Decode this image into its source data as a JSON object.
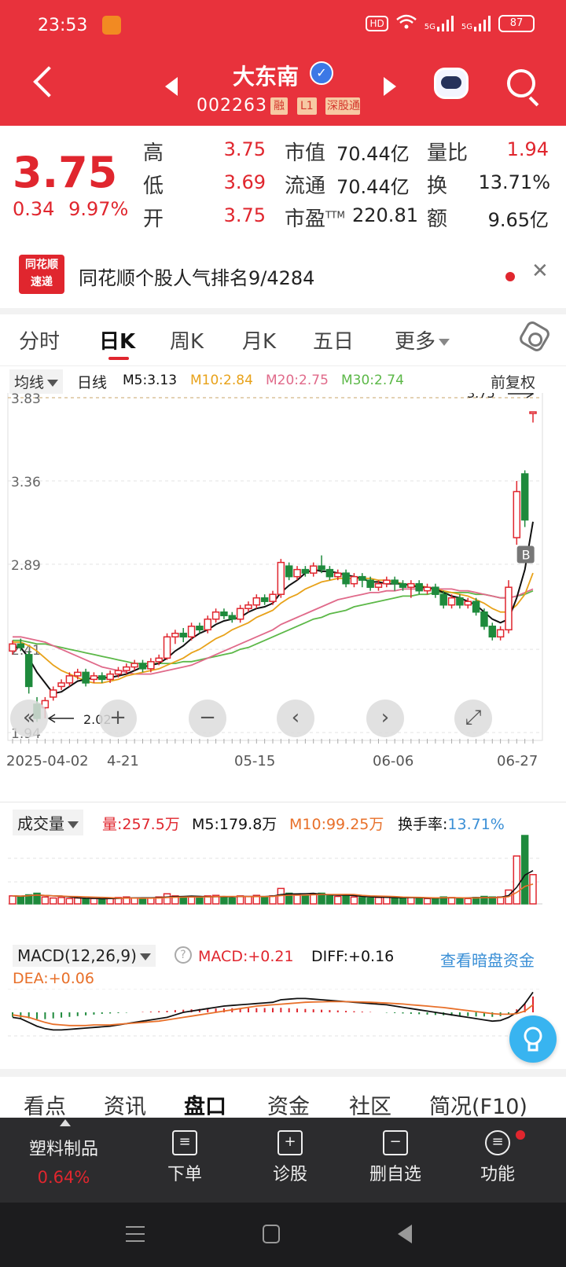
{
  "status_bar": {
    "time": "23:53",
    "network": "HD",
    "sim1": "5G",
    "sim2": "5G",
    "battery": "87"
  },
  "header": {
    "stock_name": "大东南",
    "stock_code": "002263",
    "tags": [
      "融",
      "L1",
      "深股通"
    ]
  },
  "quote": {
    "price": "3.75",
    "change": "0.34",
    "change_pct": "9.97%",
    "labels": {
      "high": "高",
      "low": "低",
      "open": "开",
      "mktcap": "市值",
      "float": "流通",
      "pe": "市盈",
      "pe_sup": "TTM",
      "vol_ratio": "量比",
      "turnover": "换",
      "amount": "额"
    },
    "high": "3.75",
    "low": "3.69",
    "open": "3.75",
    "mktcap": "70.44亿",
    "float": "70.44亿",
    "pe": "220.81",
    "vol_ratio": "1.94",
    "turnover": "13.71%",
    "amount": "9.65亿"
  },
  "ths_banner": {
    "logo_line1": "同花顺",
    "logo_line2": "速递",
    "text": "同花顺个股人气排名9/4284"
  },
  "tabs": [
    "分时",
    "日K",
    "周K",
    "月K",
    "五日",
    "更多"
  ],
  "active_tab": "日K",
  "ma_bar": {
    "button": "均线",
    "period": "日线",
    "m5": "M5:3.13",
    "m10": "M10:2.84",
    "m20": "M20:2.75",
    "m30": "M30:2.74",
    "adjust": "前复权"
  },
  "colors": {
    "up": "#e0262e",
    "down": "#1e8a3c",
    "m5": "#111111",
    "m10": "#e8a21a",
    "m20": "#e06a8a",
    "m30": "#5cb848",
    "accent": "#e8323c"
  },
  "chart_data": {
    "type": "candlestick",
    "y_ticks": [
      "3.83",
      "3.36",
      "2.89",
      "2.41",
      "1.94"
    ],
    "x_ticks": [
      "2025-04-02",
      "4-21",
      "05-15",
      "06-06",
      "06-27"
    ],
    "max_label": "3.75",
    "min_label": "2.02",
    "marker": "B",
    "candles": [
      [
        2.4,
        2.44,
        2.38,
        2.46
      ],
      [
        2.44,
        2.42,
        2.4,
        2.47
      ],
      [
        2.38,
        2.2,
        2.16,
        2.4
      ],
      [
        2.1,
        2.02,
        2.0,
        2.14
      ],
      [
        2.08,
        2.12,
        2.02,
        2.14
      ],
      [
        2.14,
        2.18,
        2.12,
        2.2
      ],
      [
        2.2,
        2.22,
        2.18,
        2.24
      ],
      [
        2.22,
        2.26,
        2.2,
        2.28
      ],
      [
        2.26,
        2.28,
        2.24,
        2.3
      ],
      [
        2.28,
        2.22,
        2.2,
        2.3
      ],
      [
        2.24,
        2.26,
        2.22,
        2.28
      ],
      [
        2.26,
        2.24,
        2.22,
        2.28
      ],
      [
        2.24,
        2.27,
        2.22,
        2.29
      ],
      [
        2.27,
        2.29,
        2.25,
        2.31
      ],
      [
        2.29,
        2.31,
        2.27,
        2.33
      ],
      [
        2.31,
        2.33,
        2.29,
        2.35
      ],
      [
        2.33,
        2.3,
        2.28,
        2.35
      ],
      [
        2.3,
        2.34,
        2.28,
        2.36
      ],
      [
        2.34,
        2.36,
        2.32,
        2.38
      ],
      [
        2.36,
        2.48,
        2.35,
        2.5
      ],
      [
        2.48,
        2.5,
        2.44,
        2.52
      ],
      [
        2.5,
        2.48,
        2.45,
        2.53
      ],
      [
        2.48,
        2.54,
        2.46,
        2.56
      ],
      [
        2.54,
        2.52,
        2.5,
        2.56
      ],
      [
        2.52,
        2.58,
        2.5,
        2.6
      ],
      [
        2.58,
        2.62,
        2.56,
        2.64
      ],
      [
        2.62,
        2.6,
        2.58,
        2.64
      ],
      [
        2.6,
        2.58,
        2.56,
        2.62
      ],
      [
        2.58,
        2.64,
        2.56,
        2.66
      ],
      [
        2.64,
        2.66,
        2.62,
        2.68
      ],
      [
        2.66,
        2.7,
        2.64,
        2.72
      ],
      [
        2.7,
        2.68,
        2.66,
        2.72
      ],
      [
        2.68,
        2.72,
        2.66,
        2.74
      ],
      [
        2.72,
        2.9,
        2.7,
        2.92
      ],
      [
        2.88,
        2.82,
        2.8,
        2.9
      ],
      [
        2.82,
        2.86,
        2.8,
        2.88
      ],
      [
        2.86,
        2.84,
        2.82,
        2.88
      ],
      [
        2.84,
        2.88,
        2.82,
        2.9
      ],
      [
        2.88,
        2.86,
        2.84,
        2.94
      ],
      [
        2.86,
        2.82,
        2.8,
        2.88
      ],
      [
        2.82,
        2.84,
        2.8,
        2.86
      ],
      [
        2.84,
        2.78,
        2.76,
        2.86
      ],
      [
        2.78,
        2.82,
        2.76,
        2.84
      ],
      [
        2.82,
        2.8,
        2.76,
        2.84
      ],
      [
        2.8,
        2.76,
        2.74,
        2.82
      ],
      [
        2.76,
        2.78,
        2.74,
        2.8
      ],
      [
        2.78,
        2.8,
        2.76,
        2.82
      ],
      [
        2.8,
        2.78,
        2.74,
        2.82
      ],
      [
        2.78,
        2.76,
        2.74,
        2.8
      ],
      [
        2.76,
        2.78,
        2.7,
        2.8
      ],
      [
        2.78,
        2.74,
        2.72,
        2.8
      ],
      [
        2.74,
        2.76,
        2.72,
        2.78
      ],
      [
        2.76,
        2.72,
        2.7,
        2.78
      ],
      [
        2.72,
        2.66,
        2.64,
        2.74
      ],
      [
        2.66,
        2.7,
        2.64,
        2.72
      ],
      [
        2.7,
        2.66,
        2.64,
        2.72
      ],
      [
        2.66,
        2.68,
        2.64,
        2.7
      ],
      [
        2.68,
        2.62,
        2.6,
        2.7
      ],
      [
        2.62,
        2.54,
        2.52,
        2.64
      ],
      [
        2.54,
        2.48,
        2.46,
        2.56
      ],
      [
        2.48,
        2.52,
        2.46,
        2.54
      ],
      [
        2.52,
        2.76,
        2.5,
        2.8
      ],
      [
        3.04,
        3.3,
        3.0,
        3.36
      ],
      [
        3.4,
        3.14,
        3.1,
        3.42
      ],
      [
        3.75,
        3.75,
        3.69,
        3.75
      ]
    ],
    "ma5": [
      2.42,
      2.42,
      2.36,
      2.28,
      2.22,
      2.16,
      2.17,
      2.2,
      2.23,
      2.24,
      2.25,
      2.25,
      2.25,
      2.26,
      2.27,
      2.29,
      2.31,
      2.32,
      2.33,
      2.36,
      2.4,
      2.43,
      2.47,
      2.5,
      2.52,
      2.55,
      2.57,
      2.58,
      2.59,
      2.62,
      2.64,
      2.65,
      2.67,
      2.73,
      2.77,
      2.8,
      2.84,
      2.86,
      2.85,
      2.85,
      2.84,
      2.83,
      2.82,
      2.81,
      2.79,
      2.79,
      2.78,
      2.78,
      2.78,
      2.77,
      2.76,
      2.76,
      2.75,
      2.73,
      2.71,
      2.7,
      2.68,
      2.66,
      2.62,
      2.58,
      2.56,
      2.58,
      2.7,
      2.86,
      3.13
    ],
    "ma10": [
      2.45,
      2.45,
      2.43,
      2.4,
      2.36,
      2.32,
      2.29,
      2.27,
      2.25,
      2.23,
      2.22,
      2.22,
      2.23,
      2.24,
      2.26,
      2.27,
      2.28,
      2.29,
      2.3,
      2.32,
      2.34,
      2.36,
      2.39,
      2.41,
      2.44,
      2.47,
      2.49,
      2.52,
      2.54,
      2.56,
      2.59,
      2.61,
      2.63,
      2.67,
      2.7,
      2.72,
      2.75,
      2.77,
      2.79,
      2.8,
      2.81,
      2.81,
      2.81,
      2.81,
      2.81,
      2.8,
      2.8,
      2.79,
      2.78,
      2.77,
      2.77,
      2.76,
      2.75,
      2.74,
      2.73,
      2.72,
      2.71,
      2.69,
      2.67,
      2.64,
      2.62,
      2.62,
      2.66,
      2.72,
      2.84
    ],
    "ma20": [
      2.48,
      2.48,
      2.47,
      2.46,
      2.45,
      2.43,
      2.41,
      2.39,
      2.37,
      2.35,
      2.33,
      2.31,
      2.3,
      2.29,
      2.28,
      2.27,
      2.27,
      2.27,
      2.28,
      2.29,
      2.3,
      2.31,
      2.32,
      2.34,
      2.36,
      2.38,
      2.4,
      2.42,
      2.44,
      2.46,
      2.48,
      2.5,
      2.52,
      2.55,
      2.57,
      2.59,
      2.61,
      2.63,
      2.65,
      2.67,
      2.69,
      2.7,
      2.71,
      2.72,
      2.73,
      2.73,
      2.74,
      2.74,
      2.75,
      2.75,
      2.75,
      2.75,
      2.75,
      2.75,
      2.75,
      2.74,
      2.74,
      2.73,
      2.72,
      2.71,
      2.7,
      2.7,
      2.71,
      2.73,
      2.75
    ],
    "ma30": [
      2.46,
      2.46,
      2.45,
      2.44,
      2.44,
      2.43,
      2.42,
      2.41,
      2.4,
      2.39,
      2.38,
      2.37,
      2.36,
      2.35,
      2.34,
      2.33,
      2.33,
      2.33,
      2.33,
      2.33,
      2.33,
      2.34,
      2.34,
      2.35,
      2.36,
      2.37,
      2.38,
      2.39,
      2.41,
      2.42,
      2.44,
      2.46,
      2.48,
      2.5,
      2.52,
      2.54,
      2.56,
      2.58,
      2.59,
      2.61,
      2.62,
      2.63,
      2.65,
      2.66,
      2.67,
      2.68,
      2.69,
      2.7,
      2.71,
      2.71,
      2.72,
      2.72,
      2.73,
      2.73,
      2.73,
      2.73,
      2.73,
      2.72,
      2.72,
      2.71,
      2.7,
      2.7,
      2.71,
      2.72,
      2.74
    ]
  },
  "volume_bar": {
    "button": "成交量",
    "vol": "量:257.5万",
    "m5": "M5:179.8万",
    "m10": "M10:99.25万",
    "turnover_label": "换手率:",
    "turnover": "13.71%",
    "volumes": [
      30,
      28,
      34,
      40,
      26,
      22,
      24,
      20,
      22,
      18,
      20,
      18,
      22,
      24,
      26,
      22,
      20,
      22,
      26,
      38,
      30,
      24,
      28,
      22,
      30,
      32,
      26,
      22,
      30,
      28,
      32,
      26,
      30,
      58,
      40,
      34,
      30,
      36,
      40,
      30,
      28,
      32,
      26,
      24,
      22,
      24,
      26,
      22,
      22,
      24,
      22,
      20,
      22,
      26,
      24,
      22,
      20,
      24,
      28,
      26,
      26,
      52,
      180,
      257,
      110
    ]
  },
  "macd_bar": {
    "button": "MACD(12,26,9)",
    "macd": "MACD:+0.21",
    "diff": "DIFF:+0.16",
    "dea": "DEA:+0.06",
    "link": "查看暗盘资金",
    "hist": [
      -0.06,
      -0.07,
      -0.08,
      -0.09,
      -0.09,
      -0.08,
      -0.07,
      -0.06,
      -0.05,
      -0.04,
      -0.03,
      -0.02,
      -0.015,
      -0.01,
      -0.005,
      0.0,
      0.005,
      0.01,
      0.015,
      0.02,
      0.03,
      0.035,
      0.04,
      0.045,
      0.05,
      0.05,
      0.052,
      0.055,
      0.055,
      0.056,
      0.056,
      0.057,
      0.057,
      0.06,
      0.055,
      0.05,
      0.045,
      0.04,
      0.035,
      0.03,
      0.025,
      0.02,
      0.015,
      0.01,
      0.005,
      0.0,
      -0.005,
      -0.01,
      -0.015,
      -0.02,
      -0.025,
      -0.03,
      -0.035,
      -0.04,
      -0.045,
      -0.05,
      -0.05,
      -0.055,
      -0.055,
      -0.06,
      -0.05,
      -0.02,
      0.04,
      0.12,
      0.21
    ],
    "diff_line": [
      -0.04,
      -0.05,
      -0.08,
      -0.11,
      -0.13,
      -0.14,
      -0.14,
      -0.135,
      -0.13,
      -0.125,
      -0.12,
      -0.115,
      -0.11,
      -0.1,
      -0.09,
      -0.08,
      -0.07,
      -0.06,
      -0.05,
      -0.04,
      -0.02,
      0.0,
      0.01,
      0.02,
      0.03,
      0.04,
      0.05,
      0.055,
      0.06,
      0.065,
      0.07,
      0.075,
      0.08,
      0.1,
      0.105,
      0.11,
      0.11,
      0.105,
      0.1,
      0.095,
      0.09,
      0.085,
      0.08,
      0.075,
      0.07,
      0.065,
      0.06,
      0.05,
      0.04,
      0.03,
      0.02,
      0.01,
      0.0,
      -0.01,
      -0.02,
      -0.03,
      -0.04,
      -0.05,
      -0.06,
      -0.07,
      -0.065,
      -0.04,
      0.0,
      0.07,
      0.16
    ],
    "dea_line": [
      -0.02,
      -0.03,
      -0.04,
      -0.06,
      -0.08,
      -0.095,
      -0.1,
      -0.105,
      -0.105,
      -0.105,
      -0.1,
      -0.1,
      -0.1,
      -0.095,
      -0.09,
      -0.085,
      -0.08,
      -0.075,
      -0.07,
      -0.06,
      -0.05,
      -0.04,
      -0.03,
      -0.02,
      -0.01,
      0.0,
      0.01,
      0.02,
      0.03,
      0.04,
      0.05,
      0.055,
      0.06,
      0.065,
      0.07,
      0.075,
      0.08,
      0.082,
      0.084,
      0.085,
      0.085,
      0.085,
      0.084,
      0.082,
      0.08,
      0.077,
      0.074,
      0.07,
      0.066,
      0.06,
      0.055,
      0.05,
      0.044,
      0.038,
      0.03,
      0.022,
      0.014,
      0.006,
      -0.002,
      -0.01,
      -0.015,
      -0.015,
      -0.01,
      0.01,
      0.06
    ]
  },
  "controls": {
    "rewind": "«",
    "zoom_in": "+",
    "zoom_out": "−",
    "prev": "‹",
    "next": "›",
    "fullscreen": "⤢"
  },
  "bottom_tabs": [
    "看点",
    "资讯",
    "盘口",
    "资金",
    "社区",
    "简况(F10)"
  ],
  "active_bottom_tab": "盘口",
  "toolbar": {
    "sector": "塑料制品",
    "sector_pct": "0.64%",
    "items": [
      "下单",
      "诊股",
      "删自选",
      "功能"
    ]
  }
}
